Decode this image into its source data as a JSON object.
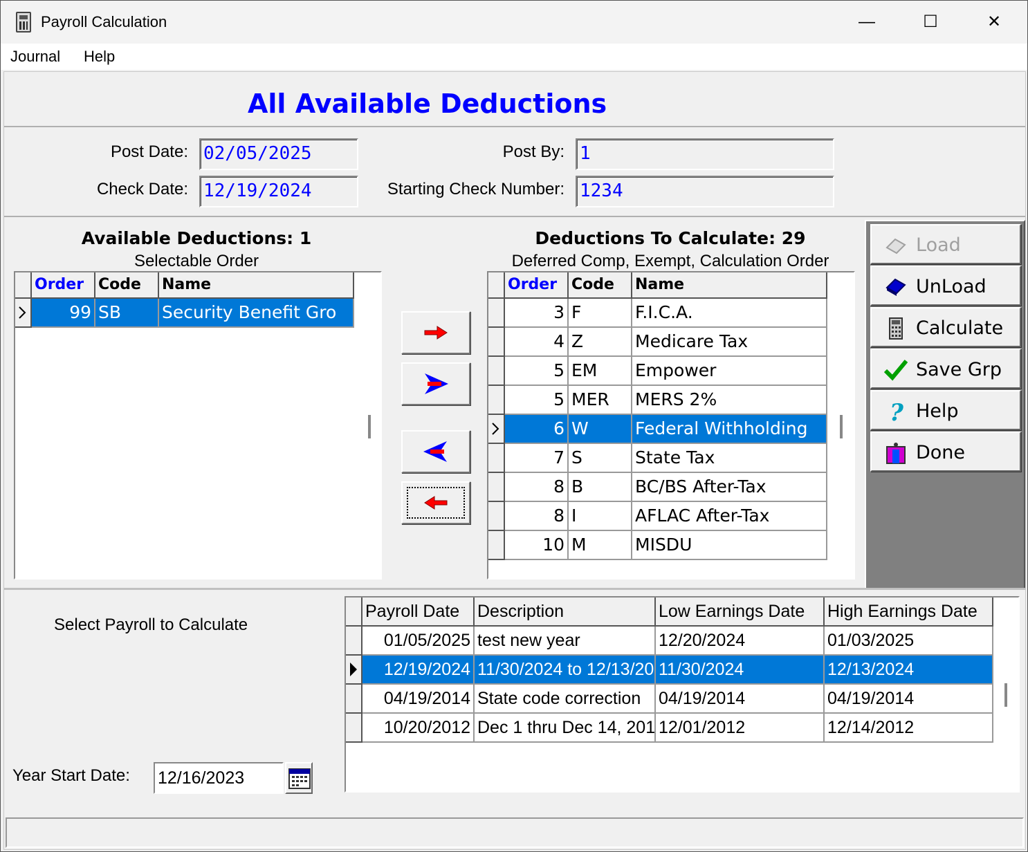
{
  "window": {
    "title": "Payroll Calculation",
    "min": "—",
    "max": "☐",
    "close": "✕"
  },
  "menu": [
    "Journal",
    "Help"
  ],
  "header": {
    "title": "All Available Deductions"
  },
  "form": {
    "post_date_label": "Post Date:",
    "post_date": "02/05/2025",
    "check_date_label": "Check Date:",
    "check_date": "12/19/2024",
    "post_by_label": "Post By:",
    "post_by": "1",
    "start_check_label": "Starting Check Number:",
    "start_check": "1234"
  },
  "available": {
    "title": "Available Deductions: 1",
    "subtitle": "Selectable Order",
    "columns": [
      "Order",
      "Code",
      "Name"
    ],
    "rows": [
      {
        "order": "99",
        "code": "SB",
        "name": "Security Benefit Gro",
        "selected": true
      }
    ]
  },
  "calculate": {
    "title": "Deductions To Calculate: 29",
    "subtitle": "Deferred Comp, Exempt, Calculation Order",
    "columns": [
      "Order",
      "Code",
      "Name"
    ],
    "rows": [
      {
        "order": "3",
        "code": "F",
        "name": "F.I.C.A."
      },
      {
        "order": "4",
        "code": "Z",
        "name": "Medicare Tax"
      },
      {
        "order": "5",
        "code": "EM",
        "name": "Empower"
      },
      {
        "order": "5",
        "code": "MER",
        "name": "MERS 2%"
      },
      {
        "order": "6",
        "code": "W",
        "name": "Federal Withholding",
        "selected": true
      },
      {
        "order": "7",
        "code": "S",
        "name": "State Tax"
      },
      {
        "order": "8",
        "code": "B",
        "name": "BC/BS After-Tax"
      },
      {
        "order": "8",
        "code": "I",
        "name": "AFLAC After-Tax"
      },
      {
        "order": "10",
        "code": "M",
        "name": "MISDU"
      }
    ]
  },
  "buttons": {
    "load": "Load",
    "unload": "UnLoad",
    "calculate": "Calculate",
    "save_grp": "Save Grp",
    "help": "Help",
    "done": "Done"
  },
  "payroll": {
    "label": "Select Payroll to Calculate",
    "columns": [
      "Payroll Date",
      "Description",
      "Low Earnings Date",
      "High Earnings Date"
    ],
    "rows": [
      {
        "date": "01/05/2025",
        "desc": "test new year",
        "low": "12/20/2024",
        "high": "01/03/2025"
      },
      {
        "date": "12/19/2024",
        "desc": "11/30/2024 to 12/13/20",
        "low": "11/30/2024",
        "high": "12/13/2024",
        "selected": true
      },
      {
        "date": "04/19/2014",
        "desc": "State code correction",
        "low": "04/19/2014",
        "high": "04/19/2014"
      },
      {
        "date": "10/20/2012",
        "desc": "Dec 1 thru Dec 14, 201",
        "low": "12/01/2012",
        "high": "12/14/2012"
      }
    ]
  },
  "year_start": {
    "label": "Year Start Date:",
    "value": "12/16/2023"
  },
  "colors": {
    "accent": "#0078d7",
    "heading": "#0000ff",
    "arrow_red": "#ff0000",
    "arrow_blue": "#0000ff"
  }
}
